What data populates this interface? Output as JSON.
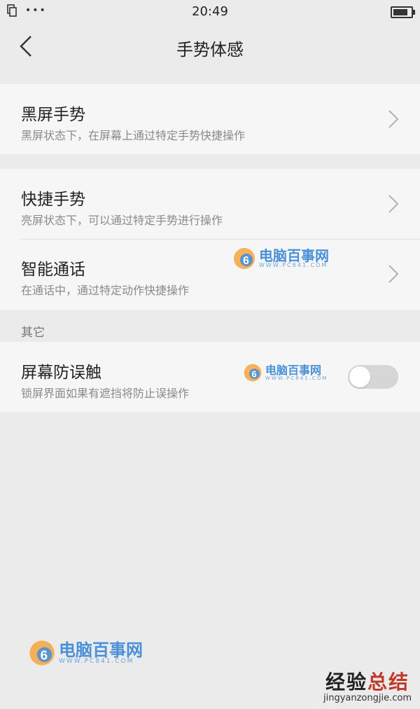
{
  "status_bar": {
    "time": "20:49",
    "dots": "•••",
    "battery_level": 0.85
  },
  "nav": {
    "title": "手势体感"
  },
  "items": [
    {
      "title": "黑屏手势",
      "subtitle": "黑屏状态下，在屏幕上通过特定手势快捷操作"
    },
    {
      "title": "快捷手势",
      "subtitle": "亮屏状态下，可以通过特定手势进行操作"
    },
    {
      "title": "智能通话",
      "subtitle": "在通话中，通过特定动作快捷操作"
    }
  ],
  "other": {
    "header": "其它",
    "item": {
      "title": "屏幕防误触",
      "subtitle": "锁屏界面如果有遮挡将防止误操作",
      "toggle_on": false
    }
  },
  "watermarks": {
    "brand_name": "电脑百事网",
    "brand_url": "WWW.PC841.COM",
    "site_cn_a": "经验",
    "site_cn_b": "总结",
    "site_en": "jingyanzongjie.com"
  },
  "colors": {
    "background": "#ebebeb",
    "card": "#f6f6f6",
    "toggle_off": "#d6d6d6",
    "watermark_blue": "#4a90d9"
  }
}
